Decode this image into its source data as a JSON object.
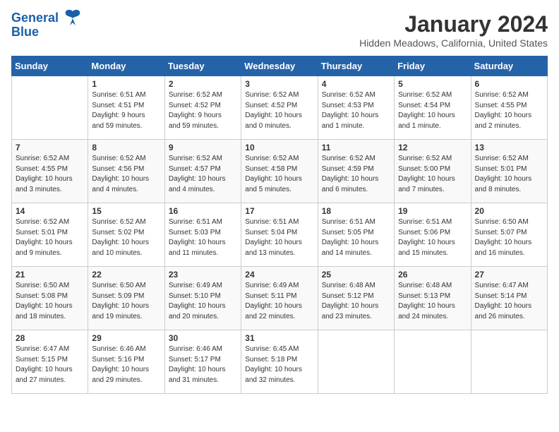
{
  "header": {
    "logo_line1": "General",
    "logo_line2": "Blue",
    "month_year": "January 2024",
    "location": "Hidden Meadows, California, United States"
  },
  "days_of_week": [
    "Sunday",
    "Monday",
    "Tuesday",
    "Wednesday",
    "Thursday",
    "Friday",
    "Saturday"
  ],
  "weeks": [
    [
      {
        "day": "",
        "info": ""
      },
      {
        "day": "1",
        "info": "Sunrise: 6:51 AM\nSunset: 4:51 PM\nDaylight: 9 hours\nand 59 minutes."
      },
      {
        "day": "2",
        "info": "Sunrise: 6:52 AM\nSunset: 4:52 PM\nDaylight: 9 hours\nand 59 minutes."
      },
      {
        "day": "3",
        "info": "Sunrise: 6:52 AM\nSunset: 4:52 PM\nDaylight: 10 hours\nand 0 minutes."
      },
      {
        "day": "4",
        "info": "Sunrise: 6:52 AM\nSunset: 4:53 PM\nDaylight: 10 hours\nand 1 minute."
      },
      {
        "day": "5",
        "info": "Sunrise: 6:52 AM\nSunset: 4:54 PM\nDaylight: 10 hours\nand 1 minute."
      },
      {
        "day": "6",
        "info": "Sunrise: 6:52 AM\nSunset: 4:55 PM\nDaylight: 10 hours\nand 2 minutes."
      }
    ],
    [
      {
        "day": "7",
        "info": "Sunrise: 6:52 AM\nSunset: 4:55 PM\nDaylight: 10 hours\nand 3 minutes."
      },
      {
        "day": "8",
        "info": "Sunrise: 6:52 AM\nSunset: 4:56 PM\nDaylight: 10 hours\nand 4 minutes."
      },
      {
        "day": "9",
        "info": "Sunrise: 6:52 AM\nSunset: 4:57 PM\nDaylight: 10 hours\nand 4 minutes."
      },
      {
        "day": "10",
        "info": "Sunrise: 6:52 AM\nSunset: 4:58 PM\nDaylight: 10 hours\nand 5 minutes."
      },
      {
        "day": "11",
        "info": "Sunrise: 6:52 AM\nSunset: 4:59 PM\nDaylight: 10 hours\nand 6 minutes."
      },
      {
        "day": "12",
        "info": "Sunrise: 6:52 AM\nSunset: 5:00 PM\nDaylight: 10 hours\nand 7 minutes."
      },
      {
        "day": "13",
        "info": "Sunrise: 6:52 AM\nSunset: 5:01 PM\nDaylight: 10 hours\nand 8 minutes."
      }
    ],
    [
      {
        "day": "14",
        "info": "Sunrise: 6:52 AM\nSunset: 5:01 PM\nDaylight: 10 hours\nand 9 minutes."
      },
      {
        "day": "15",
        "info": "Sunrise: 6:52 AM\nSunset: 5:02 PM\nDaylight: 10 hours\nand 10 minutes."
      },
      {
        "day": "16",
        "info": "Sunrise: 6:51 AM\nSunset: 5:03 PM\nDaylight: 10 hours\nand 11 minutes."
      },
      {
        "day": "17",
        "info": "Sunrise: 6:51 AM\nSunset: 5:04 PM\nDaylight: 10 hours\nand 13 minutes."
      },
      {
        "day": "18",
        "info": "Sunrise: 6:51 AM\nSunset: 5:05 PM\nDaylight: 10 hours\nand 14 minutes."
      },
      {
        "day": "19",
        "info": "Sunrise: 6:51 AM\nSunset: 5:06 PM\nDaylight: 10 hours\nand 15 minutes."
      },
      {
        "day": "20",
        "info": "Sunrise: 6:50 AM\nSunset: 5:07 PM\nDaylight: 10 hours\nand 16 minutes."
      }
    ],
    [
      {
        "day": "21",
        "info": "Sunrise: 6:50 AM\nSunset: 5:08 PM\nDaylight: 10 hours\nand 18 minutes."
      },
      {
        "day": "22",
        "info": "Sunrise: 6:50 AM\nSunset: 5:09 PM\nDaylight: 10 hours\nand 19 minutes."
      },
      {
        "day": "23",
        "info": "Sunrise: 6:49 AM\nSunset: 5:10 PM\nDaylight: 10 hours\nand 20 minutes."
      },
      {
        "day": "24",
        "info": "Sunrise: 6:49 AM\nSunset: 5:11 PM\nDaylight: 10 hours\nand 22 minutes."
      },
      {
        "day": "25",
        "info": "Sunrise: 6:48 AM\nSunset: 5:12 PM\nDaylight: 10 hours\nand 23 minutes."
      },
      {
        "day": "26",
        "info": "Sunrise: 6:48 AM\nSunset: 5:13 PM\nDaylight: 10 hours\nand 24 minutes."
      },
      {
        "day": "27",
        "info": "Sunrise: 6:47 AM\nSunset: 5:14 PM\nDaylight: 10 hours\nand 26 minutes."
      }
    ],
    [
      {
        "day": "28",
        "info": "Sunrise: 6:47 AM\nSunset: 5:15 PM\nDaylight: 10 hours\nand 27 minutes."
      },
      {
        "day": "29",
        "info": "Sunrise: 6:46 AM\nSunset: 5:16 PM\nDaylight: 10 hours\nand 29 minutes."
      },
      {
        "day": "30",
        "info": "Sunrise: 6:46 AM\nSunset: 5:17 PM\nDaylight: 10 hours\nand 31 minutes."
      },
      {
        "day": "31",
        "info": "Sunrise: 6:45 AM\nSunset: 5:18 PM\nDaylight: 10 hours\nand 32 minutes."
      },
      {
        "day": "",
        "info": ""
      },
      {
        "day": "",
        "info": ""
      },
      {
        "day": "",
        "info": ""
      }
    ]
  ]
}
